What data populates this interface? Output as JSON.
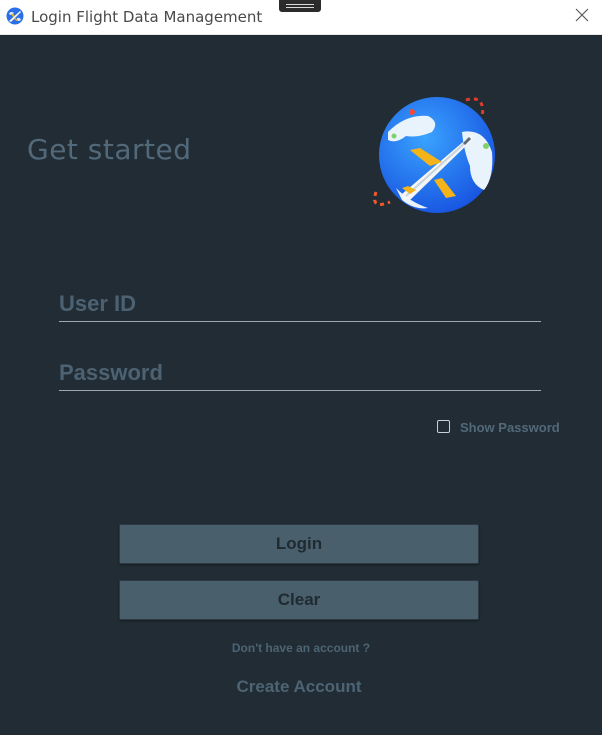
{
  "window": {
    "title": "Login Flight Data Management",
    "app_icon": "globe-plane-icon",
    "close_icon": "close-icon"
  },
  "header": {
    "heading": "Get started",
    "illustration": "globe-airplane-icon"
  },
  "form": {
    "user_id": {
      "placeholder": "User ID",
      "value": ""
    },
    "password": {
      "placeholder": "Password",
      "value": ""
    },
    "show_password": {
      "label": "Show Password",
      "checked": false
    }
  },
  "actions": {
    "login_label": "Login",
    "clear_label": "Clear"
  },
  "footer": {
    "prompt": "Don't have an account ?",
    "create_account_label": "Create Account"
  },
  "colors": {
    "background": "#222c34",
    "accent_text": "#52697a",
    "button_fill": "#4a5f6c"
  }
}
